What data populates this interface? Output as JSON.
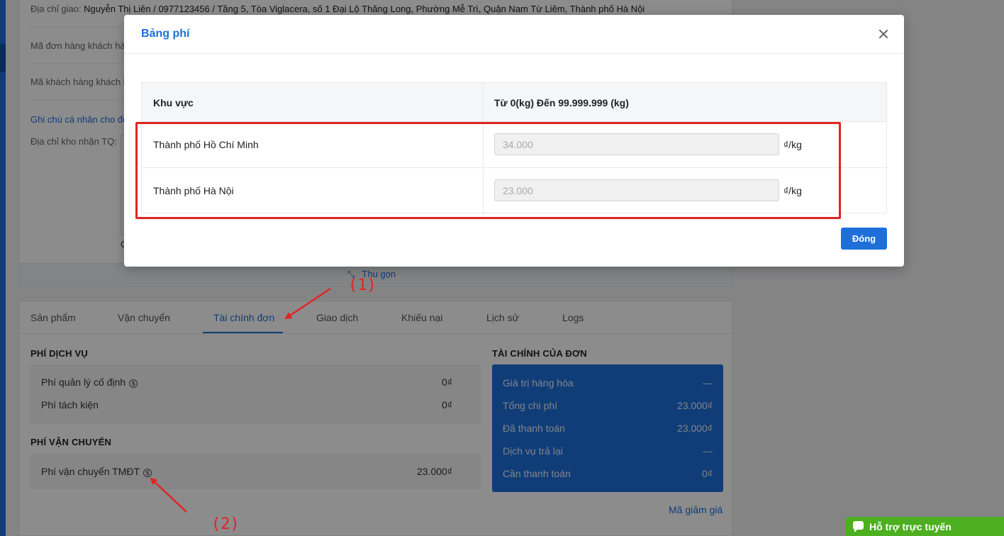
{
  "background": {
    "info": {
      "delivery_label": "Địa chỉ giao:",
      "delivery_value": "Nguyễn Thị Liên / 0977123456 / Tầng 5, Tòa Viglacera, số 1 Đại Lộ Thăng Long, Phường Mễ Trì, Quận Nam Từ Liêm, Thành phố Hà Nội",
      "customer_order_code_label": "Mã đơn hàng khách hàn",
      "customer_code_label": "Mã khách hàng khách h",
      "personal_note_link": "Ghi chú cá nhân cho đơ",
      "warehouse_label": "Địa chỉ kho nhận TQ:",
      "warehouse_fragment": "C",
      "collapse_label": "Thu gọn"
    },
    "tabs": [
      "Sản phẩm",
      "Vận chuyển",
      "Tài chính đơn",
      "Giao dịch",
      "Khiếu nại",
      "Lịch sử",
      "Logs"
    ],
    "active_tab": "Tài chính đơn",
    "service_fees": {
      "title": "PHÍ DỊCH VỤ",
      "rows": [
        {
          "label": "Phí quản lý cố định",
          "value": "0₫",
          "has_info_icon": true
        },
        {
          "label": "Phí tách kiện",
          "value": "0₫",
          "has_info_icon": false
        }
      ]
    },
    "shipping_fees": {
      "title": "PHÍ VẬN CHUYỂN",
      "rows": [
        {
          "label": "Phí vận chuyển TMĐT",
          "value": "23.000₫",
          "has_info_icon": true
        }
      ]
    },
    "order_finance": {
      "title": "TÀI CHÍNH CỦA ĐƠN",
      "rows": [
        {
          "label": "Giá trị hàng hóa",
          "value": "---"
        },
        {
          "label": "Tổng chi phí",
          "value": "23.000₫"
        },
        {
          "label": "Đã thanh toán",
          "value": "23.000₫"
        },
        {
          "label": "Dịch vụ trả lại",
          "value": "---"
        },
        {
          "label": "Cần thanh toán",
          "value": "0₫"
        }
      ],
      "discount_link": "Mã giảm giá"
    },
    "support_chat": "Hỗ trợ trực tuyến"
  },
  "modal": {
    "title": "Bảng phí",
    "table": {
      "headers": [
        "Khu vực",
        "Từ 0(kg) Đến 99.999.999 (kg)"
      ],
      "rows": [
        {
          "region": "Thành phố Hồ Chí Minh",
          "price": "34.000",
          "unit": "₫/kg"
        },
        {
          "region": "Thành phố Hà Nội",
          "price": "23.000",
          "unit": "₫/kg"
        }
      ]
    },
    "close_button": "Đóng"
  },
  "annotations": {
    "label_1": "(1)",
    "label_2": "(2)",
    "color": "#e02424"
  },
  "colors": {
    "accent": "#1e6fd9",
    "support_green": "#4caf1f"
  }
}
